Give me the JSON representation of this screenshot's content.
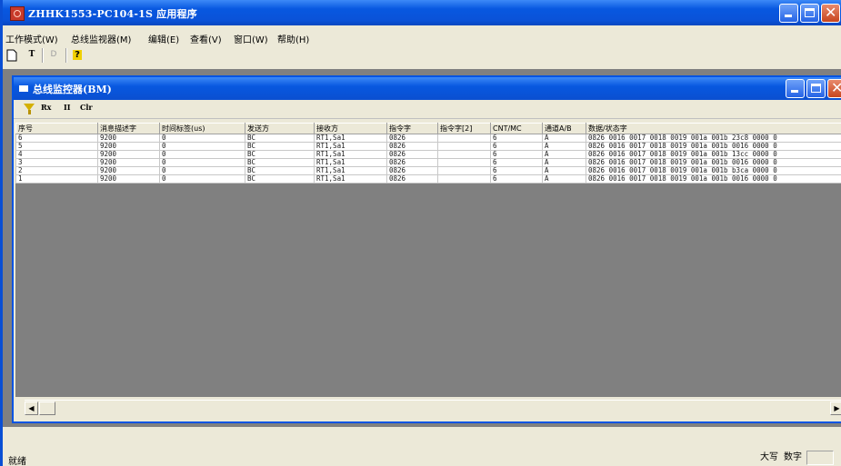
{
  "window": {
    "title": "ZHHK1553-PC104-1S 应用程序"
  },
  "menu": [
    "工作模式(W)",
    "总线监视器(M)",
    "编辑(E)",
    "查看(V)",
    "窗口(W)",
    "帮助(H)"
  ],
  "toolbar": {
    "t_btn": "T",
    "d_btn": "D",
    "help_glyph": "?"
  },
  "child_window": {
    "title": "总线监控器(BM)"
  },
  "child_toolbar": {
    "rx": "Rx",
    "pause": "II",
    "clr": "Clr"
  },
  "table": {
    "columns": [
      "序号",
      "消息描述字",
      "时间标签(us)",
      "发送方",
      "接收方",
      "指令字",
      "指令字[2]",
      "CNT/MC",
      "通道A/B",
      "数据/状态字"
    ],
    "rows": [
      [
        "6",
        "9200",
        "0",
        "BC",
        "RT1,Sa1",
        "0826",
        "",
        "6",
        "A",
        "0826 0016 0017 0018 0019 001a 001b 23c8 0000 0"
      ],
      [
        "5",
        "9200",
        "0",
        "BC",
        "RT1,Sa1",
        "0826",
        "",
        "6",
        "A",
        "0826 0016 0017 0018 0019 001a 001b 0016 0000 0"
      ],
      [
        "4",
        "9200",
        "0",
        "BC",
        "RT1,Sa1",
        "0826",
        "",
        "6",
        "A",
        "0826 0016 0017 0018 0019 001a 001b 13cc 0000 0"
      ],
      [
        "3",
        "9200",
        "0",
        "BC",
        "RT1,Sa1",
        "0826",
        "",
        "6",
        "A",
        "0826 0016 0017 0018 0019 001a 001b 0016 0000 0"
      ],
      [
        "2",
        "9200",
        "0",
        "BC",
        "RT1,Sa1",
        "0826",
        "",
        "6",
        "A",
        "0826 0016 0017 0018 0019 001a 001b b3ca 0000 0"
      ],
      [
        "1",
        "9200",
        "0",
        "BC",
        "RT1,Sa1",
        "0826",
        "",
        "6",
        "A",
        "0826 0016 0017 0018 0019 001a 001b 0016 0000 0"
      ]
    ]
  },
  "statusbar": {
    "ready": "就绪",
    "caps": "大写",
    "num": "数字"
  },
  "colors": {
    "titlebar": "#0a52d8",
    "face": "#ece9d8",
    "mdi_bg": "#808080",
    "close": "#c8461e"
  },
  "icons": [
    "app-icon",
    "new-doc-icon",
    "help-icon",
    "filter-icon",
    "minimize-icon",
    "maximize-icon",
    "close-icon",
    "scroll-left-icon",
    "scroll-right-icon"
  ]
}
